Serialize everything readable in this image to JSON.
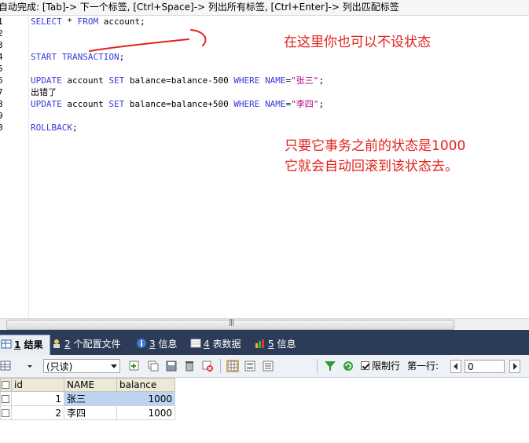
{
  "hint": "自动完成: [Tab]-> 下一个标签, [Ctrl+Space]-> 列出所有标签, [Ctrl+Enter]-> 列出匹配标签",
  "line_numbers": [
    "1",
    "2",
    "3",
    "4",
    "5",
    "6",
    "7",
    "8",
    "9",
    "0"
  ],
  "code": {
    "l1_kw1": "SELECT",
    "l1_mid": " * ",
    "l1_kw2": "FROM",
    "l1_rest": " account;",
    "l4_kw": "START TRANSACTION",
    "l4_rest": ";",
    "l6_kw1": "UPDATE",
    "l6_a": " account ",
    "l6_kw2": "SET",
    "l6_b": " balance=balance-500 ",
    "l6_kw3": "WHERE",
    "l6_c": " ",
    "l6_kw4": "NAME",
    "l6_d": "=",
    "l6_str": "\"张三\"",
    "l6_e": ";",
    "l7": "出错了",
    "l8_kw1": "UPDATE",
    "l8_a": " account ",
    "l8_kw2": "SET",
    "l8_b": " balance=balance+500 ",
    "l8_kw3": "WHERE",
    "l8_c": " ",
    "l8_kw4": "NAME",
    "l8_d": "=",
    "l8_str": "\"李四\"",
    "l8_e": ";",
    "l10_kw": "ROLLBACK",
    "l10_rest": ";"
  },
  "annotations": {
    "a1": "在这里你也可以不设状态",
    "a2_line1": "只要它事务之前的状态是1000",
    "a2_line2": "它就会自动回滚到该状态去。"
  },
  "colors": {
    "annotation": "#e2211c",
    "keyword": "#3a3ad8",
    "string": "#b0007a",
    "tabstrip": "#2c3b57"
  },
  "tabs": [
    {
      "num": "1",
      "label": "结果",
      "icon": "grid-icon"
    },
    {
      "num": "2",
      "label": "个配置文件",
      "icon": "profile-icon"
    },
    {
      "num": "3",
      "label": "信息",
      "icon": "info-icon"
    },
    {
      "num": "4",
      "label": "表数据",
      "icon": "table-icon"
    },
    {
      "num": "5",
      "label": "信息",
      "icon": "info-icon"
    }
  ],
  "toolbar": {
    "mode_select": "(只读)",
    "limit_label": "限制行",
    "first_row_label": "第一行:",
    "first_row_value": "0"
  },
  "grid": {
    "columns": [
      "id",
      "NAME",
      "balance"
    ],
    "rows": [
      {
        "id": "1",
        "NAME": "张三",
        "balance": "1000"
      },
      {
        "id": "2",
        "NAME": "李四",
        "balance": "1000"
      }
    ]
  }
}
